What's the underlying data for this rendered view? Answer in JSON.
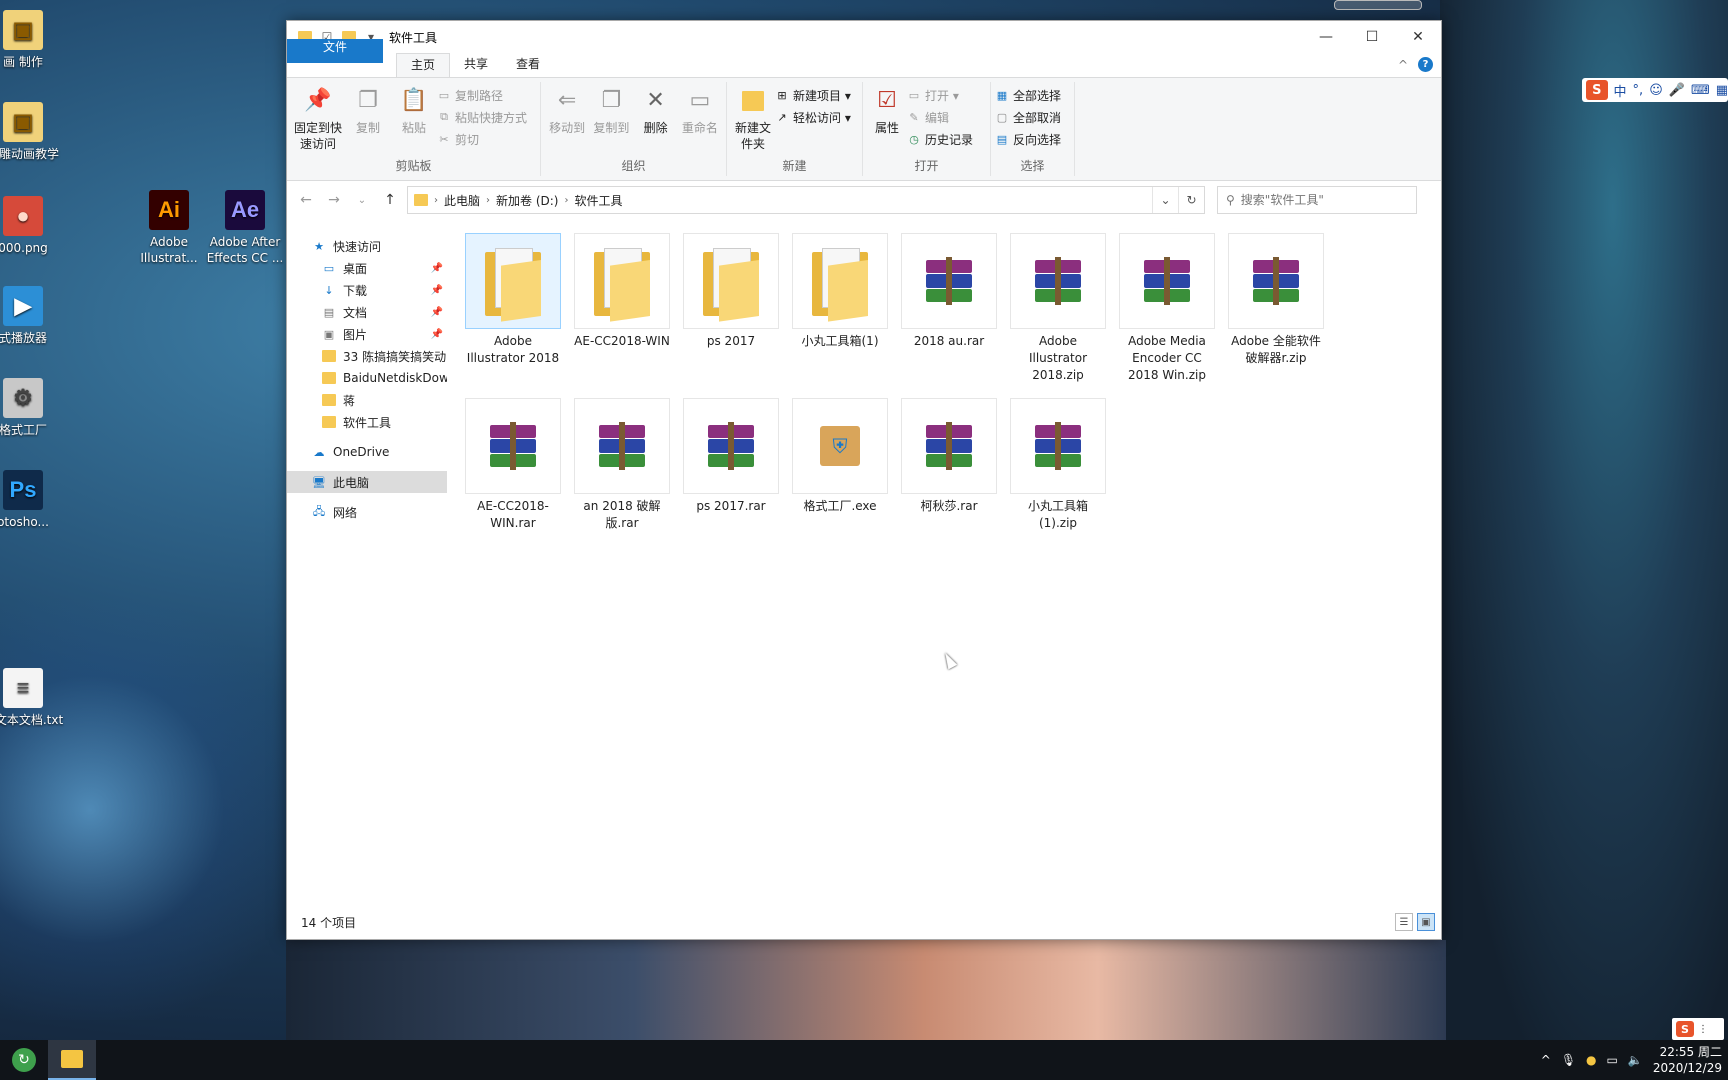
{
  "desktop": {
    "icons": [
      {
        "label": "画 制作",
        "glyph": "▣",
        "bg": "#f0d27a",
        "color": "#8a5a00"
      },
      {
        "label": "沙雕动画教学",
        "glyph": "▣",
        "bg": "#f0d27a",
        "color": "#8a5a00"
      },
      {
        "label": "000.png",
        "glyph": "●",
        "bg": "#d64a3a",
        "color": "#ffd9c9"
      },
      {
        "label": "式播放器",
        "glyph": "▶",
        "bg": "#2c8fd6",
        "color": "#ffffff"
      },
      {
        "label": "格式工厂",
        "glyph": "⚙",
        "bg": "#c8c8c8",
        "color": "#444444"
      },
      {
        "label": "otosho...",
        "glyph": "Ps",
        "bg": "#0f2a4a",
        "color": "#31a8ff"
      },
      {
        "label": "建文本文档.txt",
        "glyph": "≡",
        "bg": "#f4f4f4",
        "color": "#555555"
      },
      {
        "label": "Adobe Illustrat...",
        "glyph": "Ai",
        "bg": "#330000",
        "color": "#ff9a00"
      },
      {
        "label": "Adobe After Effects CC ...",
        "glyph": "Ae",
        "bg": "#1a0a3c",
        "color": "#9999ff"
      }
    ]
  },
  "window": {
    "title": "软件工具",
    "controls": {
      "minimize": "—",
      "maximize": "☐",
      "close": "✕"
    }
  },
  "tabs": {
    "file": "文件",
    "home": "主页",
    "share": "共享",
    "view": "查看",
    "collapse": "^",
    "help": "?"
  },
  "ribbon": {
    "clipboard": {
      "label": "剪贴板",
      "pin": "固定到快速访问",
      "copy": "复制",
      "paste": "粘贴",
      "copy_path": "复制路径",
      "paste_shortcut": "粘贴快捷方式",
      "cut": "剪切"
    },
    "organize": {
      "label": "组织",
      "move_to": "移动到",
      "copy_to": "复制到",
      "delete": "删除",
      "rename": "重命名"
    },
    "new": {
      "label": "新建",
      "new_folder": "新建文件夹",
      "new_item": "新建项目 ▾",
      "easy_access": "轻松访问 ▾"
    },
    "open": {
      "label": "打开",
      "properties": "属性",
      "open": "打开 ▾",
      "edit": "编辑",
      "history": "历史记录"
    },
    "select": {
      "label": "选择",
      "select_all": "全部选择",
      "select_none": "全部取消",
      "invert": "反向选择"
    }
  },
  "address": {
    "crumbs": [
      "此电脑",
      "新加卷 (D:)",
      "软件工具"
    ],
    "search_placeholder": "搜索\"软件工具\""
  },
  "navpane": {
    "quick_access": "快速访问",
    "items": [
      {
        "label": "桌面",
        "pinned": true,
        "icon": "desktop"
      },
      {
        "label": "下载",
        "pinned": true,
        "icon": "download"
      },
      {
        "label": "文档",
        "pinned": true,
        "icon": "document"
      },
      {
        "label": "图片",
        "pinned": true,
        "icon": "picture"
      },
      {
        "label": "33 陈搞搞笑搞笑动",
        "pinned": false,
        "icon": "folder"
      },
      {
        "label": "BaiduNetdiskDow",
        "pinned": false,
        "icon": "folder"
      },
      {
        "label": "蒋",
        "pinned": false,
        "icon": "folder"
      },
      {
        "label": "软件工具",
        "pinned": false,
        "icon": "folder"
      }
    ],
    "onedrive": "OneDrive",
    "this_pc": "此电脑",
    "network": "网络"
  },
  "files": [
    {
      "name": "Adobe Illustrator 2018",
      "type": "folder",
      "selected": true
    },
    {
      "name": "AE-CC2018-WIN",
      "type": "folder"
    },
    {
      "name": "ps 2017",
      "type": "folder"
    },
    {
      "name": "小丸工具箱(1)",
      "type": "folder"
    },
    {
      "name": "2018 au.rar",
      "type": "rar"
    },
    {
      "name": "Adobe Illustrator 2018.zip",
      "type": "rar"
    },
    {
      "name": "Adobe Media Encoder CC 2018 Win.zip",
      "type": "rar"
    },
    {
      "name": "Adobe 全能软件破解器r.zip",
      "type": "rar"
    },
    {
      "name": "AE-CC2018-WIN.rar",
      "type": "rar"
    },
    {
      "name": "an 2018 破解版.rar",
      "type": "rar"
    },
    {
      "name": "ps 2017.rar",
      "type": "rar"
    },
    {
      "name": "格式工厂.exe",
      "type": "exe"
    },
    {
      "name": "柯秋莎.rar",
      "type": "rar"
    },
    {
      "name": "小丸工具箱(1).zip",
      "type": "rar"
    }
  ],
  "status": {
    "count": "14 个项目"
  },
  "taskbar": {
    "clock_time": "22:55 周二",
    "clock_date": "2020/12/29"
  },
  "ime": {
    "logo": "S",
    "mode": "中",
    "punct": "°,"
  }
}
